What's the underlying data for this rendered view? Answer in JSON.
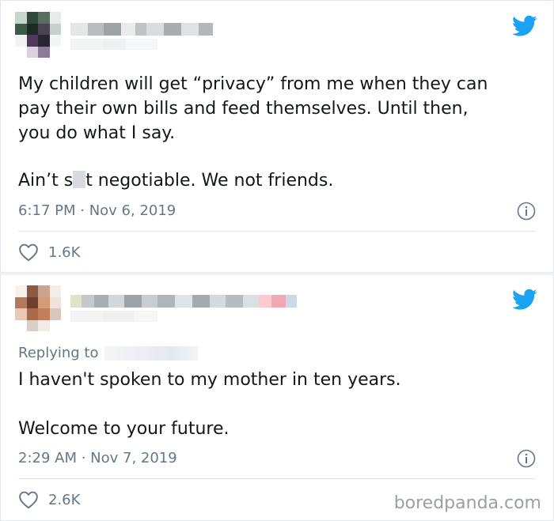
{
  "watermark": "boredpanda.com",
  "tweets": [
    {
      "text_line1": "My children will get “privacy” from me when they can",
      "text_line2": "pay their own bills and feed themselves. Until then,",
      "text_line3": "you do what I say.",
      "text_line4_a": "Ain’t s",
      "text_line4_b": "t negotiable. We not friends.",
      "timestamp": "6:17 PM · Nov 6, 2019",
      "likes": "1.6K",
      "icons": [
        "twitter-bird-icon",
        "info-icon",
        "heart-icon"
      ]
    },
    {
      "replying_to": "Replying to",
      "text_line1": "I haven't spoken to my mother in ten years.",
      "text_line2": "Welcome to your future.",
      "timestamp": "2:29 AM · Nov 7, 2019",
      "likes": "2.6K",
      "icons": [
        "twitter-bird-icon",
        "info-icon",
        "heart-icon"
      ]
    }
  ],
  "colors": {
    "twitter_blue": "#1da1f2",
    "text": "#14171a",
    "meta": "#657786",
    "border": "#e1e8ed"
  }
}
